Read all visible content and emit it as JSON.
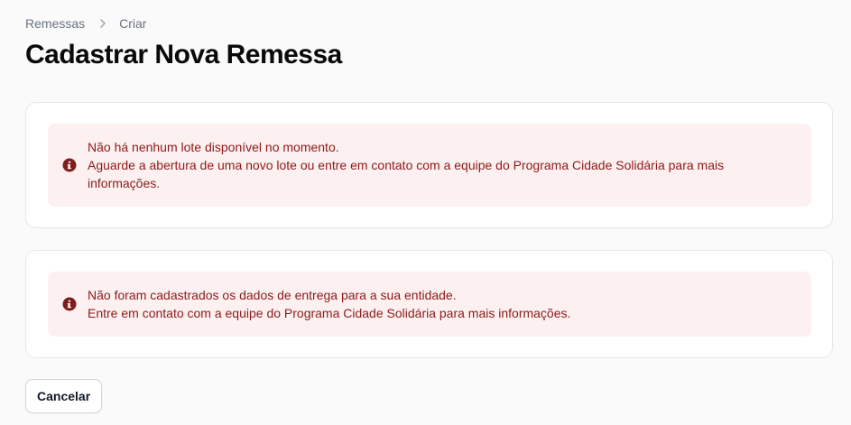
{
  "breadcrumb": {
    "items": [
      {
        "label": "Remessas"
      },
      {
        "label": "Criar"
      }
    ]
  },
  "page": {
    "title": "Cadastrar Nova Remessa"
  },
  "alerts": [
    {
      "icon": "info-circle-icon",
      "lines": [
        "Não há nenhum lote disponível no momento.",
        "Aguarde a abertura de uma novo lote ou entre em contato com a equipe do Programa Cidade Solidária para mais informações."
      ]
    },
    {
      "icon": "info-circle-icon",
      "lines": [
        "Não foram cadastrados os dados de entrega para a sua entidade.",
        "Entre em contato com a equipe do Programa Cidade Solidária para mais informações."
      ]
    }
  ],
  "actions": {
    "cancel_label": "Cancelar"
  },
  "colors": {
    "alert_bg": "#fdf0f0",
    "alert_text": "#8b1a1a",
    "alert_icon": "#7f1d1d"
  }
}
